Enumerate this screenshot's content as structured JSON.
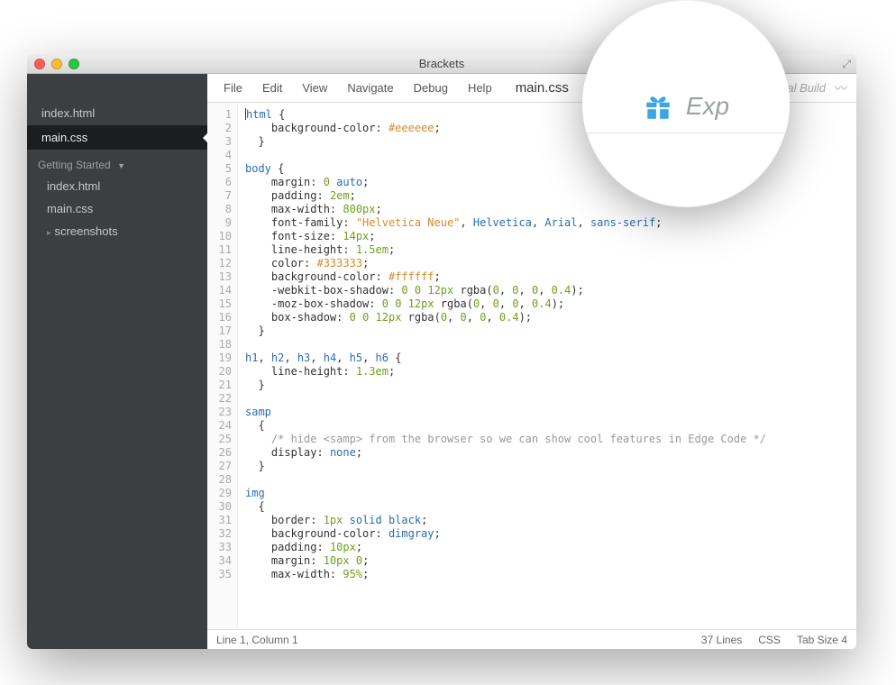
{
  "titlebar": {
    "title": "Brackets"
  },
  "sidebar": {
    "working": [
      {
        "label": "index.html"
      },
      {
        "label": "main.css",
        "active": true
      }
    ],
    "section": "Getting Started",
    "tree": [
      {
        "label": "index.html"
      },
      {
        "label": "main.css"
      },
      {
        "label": "screenshots",
        "folder": true
      }
    ]
  },
  "menubar": {
    "items": [
      "File",
      "Edit",
      "View",
      "Navigate",
      "Debug",
      "Help"
    ],
    "filename": "main.css",
    "build_label": "tal Build"
  },
  "lens": {
    "label": "Exp"
  },
  "code": {
    "lines": [
      [
        [
          "cursor",
          ""
        ],
        [
          "sel",
          "html"
        ],
        [
          "punc",
          " {"
        ]
      ],
      [
        [
          "prop",
          "    background-color"
        ],
        [
          "punc",
          ": "
        ],
        [
          "hex",
          "#eeeeee"
        ],
        [
          "punc",
          ";"
        ]
      ],
      [
        [
          "punc",
          "  }"
        ]
      ],
      [
        [
          "",
          ""
        ]
      ],
      [
        [
          "sel",
          "body"
        ],
        [
          "punc",
          " {"
        ]
      ],
      [
        [
          "prop",
          "    margin"
        ],
        [
          "punc",
          ": "
        ],
        [
          "num",
          "0"
        ],
        [
          "punc",
          " "
        ],
        [
          "kw",
          "auto"
        ],
        [
          "punc",
          ";"
        ]
      ],
      [
        [
          "prop",
          "    padding"
        ],
        [
          "punc",
          ": "
        ],
        [
          "num",
          "2em"
        ],
        [
          "punc",
          ";"
        ]
      ],
      [
        [
          "prop",
          "    max-width"
        ],
        [
          "punc",
          ": "
        ],
        [
          "num",
          "800px"
        ],
        [
          "punc",
          ";"
        ]
      ],
      [
        [
          "prop",
          "    font-family"
        ],
        [
          "punc",
          ": "
        ],
        [
          "str",
          "\"Helvetica Neue\""
        ],
        [
          "punc",
          ", "
        ],
        [
          "kw",
          "Helvetica"
        ],
        [
          "punc",
          ", "
        ],
        [
          "kw",
          "Arial"
        ],
        [
          "punc",
          ", "
        ],
        [
          "kw",
          "sans-serif"
        ],
        [
          "punc",
          ";"
        ]
      ],
      [
        [
          "prop",
          "    font-size"
        ],
        [
          "punc",
          ": "
        ],
        [
          "num",
          "14px"
        ],
        [
          "punc",
          ";"
        ]
      ],
      [
        [
          "prop",
          "    line-height"
        ],
        [
          "punc",
          ": "
        ],
        [
          "num",
          "1.5em"
        ],
        [
          "punc",
          ";"
        ]
      ],
      [
        [
          "prop",
          "    color"
        ],
        [
          "punc",
          ": "
        ],
        [
          "hex",
          "#333333"
        ],
        [
          "punc",
          ";"
        ]
      ],
      [
        [
          "prop",
          "    background-color"
        ],
        [
          "punc",
          ": "
        ],
        [
          "hex",
          "#ffffff"
        ],
        [
          "punc",
          ";"
        ]
      ],
      [
        [
          "prop",
          "    -webkit-box-shadow"
        ],
        [
          "punc",
          ": "
        ],
        [
          "num",
          "0"
        ],
        [
          "punc",
          " "
        ],
        [
          "num",
          "0"
        ],
        [
          "punc",
          " "
        ],
        [
          "num",
          "12px"
        ],
        [
          "punc",
          " rgba("
        ],
        [
          "num",
          "0"
        ],
        [
          "punc",
          ", "
        ],
        [
          "num",
          "0"
        ],
        [
          "punc",
          ", "
        ],
        [
          "num",
          "0"
        ],
        [
          "punc",
          ", "
        ],
        [
          "num",
          "0.4"
        ],
        [
          "punc",
          ");"
        ]
      ],
      [
        [
          "prop",
          "    -moz-box-shadow"
        ],
        [
          "punc",
          ": "
        ],
        [
          "num",
          "0"
        ],
        [
          "punc",
          " "
        ],
        [
          "num",
          "0"
        ],
        [
          "punc",
          " "
        ],
        [
          "num",
          "12px"
        ],
        [
          "punc",
          " rgba("
        ],
        [
          "num",
          "0"
        ],
        [
          "punc",
          ", "
        ],
        [
          "num",
          "0"
        ],
        [
          "punc",
          ", "
        ],
        [
          "num",
          "0"
        ],
        [
          "punc",
          ", "
        ],
        [
          "num",
          "0.4"
        ],
        [
          "punc",
          ");"
        ]
      ],
      [
        [
          "prop",
          "    box-shadow"
        ],
        [
          "punc",
          ": "
        ],
        [
          "num",
          "0"
        ],
        [
          "punc",
          " "
        ],
        [
          "num",
          "0"
        ],
        [
          "punc",
          " "
        ],
        [
          "num",
          "12px"
        ],
        [
          "punc",
          " rgba("
        ],
        [
          "num",
          "0"
        ],
        [
          "punc",
          ", "
        ],
        [
          "num",
          "0"
        ],
        [
          "punc",
          ", "
        ],
        [
          "num",
          "0"
        ],
        [
          "punc",
          ", "
        ],
        [
          "num",
          "0.4"
        ],
        [
          "punc",
          ");"
        ]
      ],
      [
        [
          "punc",
          "  }"
        ]
      ],
      [
        [
          "",
          ""
        ]
      ],
      [
        [
          "sel",
          "h1"
        ],
        [
          "punc",
          ", "
        ],
        [
          "sel",
          "h2"
        ],
        [
          "punc",
          ", "
        ],
        [
          "sel",
          "h3"
        ],
        [
          "punc",
          ", "
        ],
        [
          "sel",
          "h4"
        ],
        [
          "punc",
          ", "
        ],
        [
          "sel",
          "h5"
        ],
        [
          "punc",
          ", "
        ],
        [
          "sel",
          "h6"
        ],
        [
          "punc",
          " {"
        ]
      ],
      [
        [
          "prop",
          "    line-height"
        ],
        [
          "punc",
          ": "
        ],
        [
          "num",
          "1.3em"
        ],
        [
          "punc",
          ";"
        ]
      ],
      [
        [
          "punc",
          "  }"
        ]
      ],
      [
        [
          "",
          ""
        ]
      ],
      [
        [
          "sel",
          "samp"
        ]
      ],
      [
        [
          "punc",
          "  {"
        ]
      ],
      [
        [
          "comm",
          "    /* hide <samp> from the browser so we can show cool features in Edge Code */"
        ]
      ],
      [
        [
          "prop",
          "    display"
        ],
        [
          "punc",
          ": "
        ],
        [
          "kw",
          "none"
        ],
        [
          "punc",
          ";"
        ]
      ],
      [
        [
          "punc",
          "  }"
        ]
      ],
      [
        [
          "",
          ""
        ]
      ],
      [
        [
          "sel",
          "img"
        ]
      ],
      [
        [
          "punc",
          "  {"
        ]
      ],
      [
        [
          "prop",
          "    border"
        ],
        [
          "punc",
          ": "
        ],
        [
          "num",
          "1px"
        ],
        [
          "punc",
          " "
        ],
        [
          "kw",
          "solid"
        ],
        [
          "punc",
          " "
        ],
        [
          "kw",
          "black"
        ],
        [
          "punc",
          ";"
        ]
      ],
      [
        [
          "prop",
          "    background-color"
        ],
        [
          "punc",
          ": "
        ],
        [
          "kw",
          "dimgray"
        ],
        [
          "punc",
          ";"
        ]
      ],
      [
        [
          "prop",
          "    padding"
        ],
        [
          "punc",
          ": "
        ],
        [
          "num",
          "10px"
        ],
        [
          "punc",
          ";"
        ]
      ],
      [
        [
          "prop",
          "    margin"
        ],
        [
          "punc",
          ": "
        ],
        [
          "num",
          "10px"
        ],
        [
          "punc",
          " "
        ],
        [
          "num",
          "0"
        ],
        [
          "punc",
          ";"
        ]
      ],
      [
        [
          "prop",
          "    max-width"
        ],
        [
          "punc",
          ": "
        ],
        [
          "num",
          "95%"
        ],
        [
          "punc",
          ";"
        ]
      ]
    ],
    "start_line": 1
  },
  "statusbar": {
    "position": "Line 1, Column 1",
    "lines": "37 Lines",
    "lang": "CSS",
    "tab": "Tab Size  4"
  }
}
